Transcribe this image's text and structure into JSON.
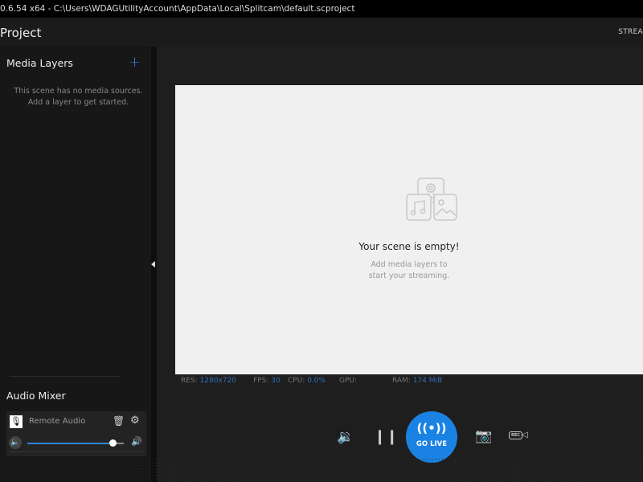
{
  "titlebar": {
    "text": "0.6.54 x64 - C:\\Users\\WDAGUtilityAccount\\AppData\\Local\\Splitcam\\default.scproject"
  },
  "header": {
    "title": "Project",
    "stream_label": "STREA"
  },
  "media_layers": {
    "title": "Media Layers",
    "add_icon": "plus-icon",
    "empty_text": "This scene has no media sources. Add a layer to get started."
  },
  "audio_mixer": {
    "title": "Audio Mixer",
    "sources": [
      {
        "name": "Remote Audio",
        "volume_percent": 88
      }
    ]
  },
  "preview": {
    "empty_title": "Your scene is empty!",
    "empty_subtitle": "Add media layers to start your streaming."
  },
  "stats": {
    "res_label": "RES:",
    "res": "1280x720",
    "fps_label": "FPS:",
    "fps": "30",
    "cpu_label": "CPU:",
    "cpu": "0.0%",
    "gpu_label": "GPU:",
    "gpu": "",
    "ram_label": "RAM:",
    "ram": "174 MiB"
  },
  "controls": {
    "go_live": "GO LIVE",
    "rec": "REC"
  },
  "colors": {
    "accent": "#1a82e2"
  }
}
